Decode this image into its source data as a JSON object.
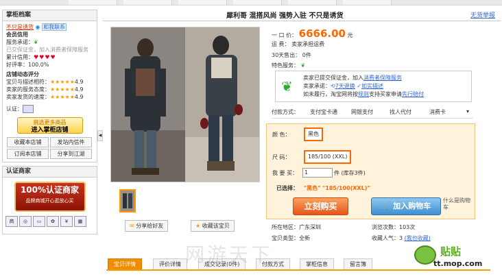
{
  "header": {
    "slogan": "犀利哥  混搭风尚  强势入驻  不只是诱货",
    "report": "无货举报"
  },
  "sidebar": {
    "shopkeeper_title": "掌柜档案",
    "not_tempting": "不只是诱货",
    "contact": "和我联系",
    "member_credit": "会员信用",
    "service_promise": "服务承诺：",
    "guarantee_note": "已交保证金，加入消费者保障服务",
    "cumulative_credit": "累计信用：",
    "positive_rate": "好评率：100.0%",
    "shop_rating_title": "店铺动态评分",
    "rating_rows": [
      {
        "label": "宝贝与描述相符：",
        "score": "4.9"
      },
      {
        "label": "卖家的服务态度：",
        "score": "4.9"
      },
      {
        "label": "卖家发货的速度：",
        "score": "4.9"
      }
    ],
    "verify_label": "认证：",
    "enter_line1": "挑选更多商品",
    "enter_line2": "进入掌柜店铺",
    "buttons": [
      "收藏本店铺",
      "发站内信件",
      "订阅本店铺",
      "分享到江湖"
    ],
    "cert_title": "认证商家",
    "cert_badge_big": "100%认证商家",
    "cert_badge_small": "品牌商城开心逛放心买"
  },
  "product": {
    "price_label": "一 口 价：",
    "price": "6666.00",
    "price_unit": "元",
    "shipping_label": "运      费：",
    "shipping_value": "卖家承担运费",
    "sold_label": "30天售出：",
    "sold_value": "0件",
    "special_label": "特色服务：",
    "service_line1_pre": "卖家已提交保证金，加入",
    "service_line1_link": "消费者保障服务",
    "service_line2_pre": "卖家承诺：",
    "service_return": "7天退换",
    "service_desc": "如实描述",
    "service_line3_pre": "如未履行，淘宝网将按",
    "service_rule": "规则",
    "service_line3_mid": "支持买家申请",
    "service_claim": "先行赔付",
    "pay_label": "付款方式：",
    "pay_methods": [
      "支付宝卡通",
      "网银支付",
      "找人代付",
      "消费卡"
    ],
    "color_label": "颜    色：",
    "color_value": "黑色",
    "size_label": "尺    码：",
    "size_value": "185/100 (XXL)",
    "qty_label": "我 要 买：",
    "qty_value": "1",
    "qty_unit": "件 (库存3件)",
    "selected_label": "已选择：",
    "selected_value": "\"黑色\"  \"185/100(XXL)\"",
    "buy_now": "立刻购买",
    "add_cart": "加入购物车",
    "what_cart": "什么是购物车",
    "location_label": "所在地区：",
    "location_value": "广东深圳",
    "type_label": "宝贝类型：",
    "type_value": "全新",
    "views_label": "浏览次数：",
    "views_value": "103次",
    "fav_label": "收藏人气：",
    "fav_value": "3",
    "fav_link": "(我也收藏)",
    "share_friend": "分享给好友",
    "fav_item": "收藏该宝贝"
  },
  "tabs": [
    "宝贝详情",
    "评价详情",
    "成交记录(0件)",
    "付款方式",
    "掌柜信息",
    "留言簿"
  ],
  "watermark": "网游天下",
  "logo": {
    "name": "贴贴",
    "url": "tt.mop.com"
  },
  "colors": {
    "accent": "#f60",
    "link": "#36c",
    "tab_active": "#f08c00"
  }
}
